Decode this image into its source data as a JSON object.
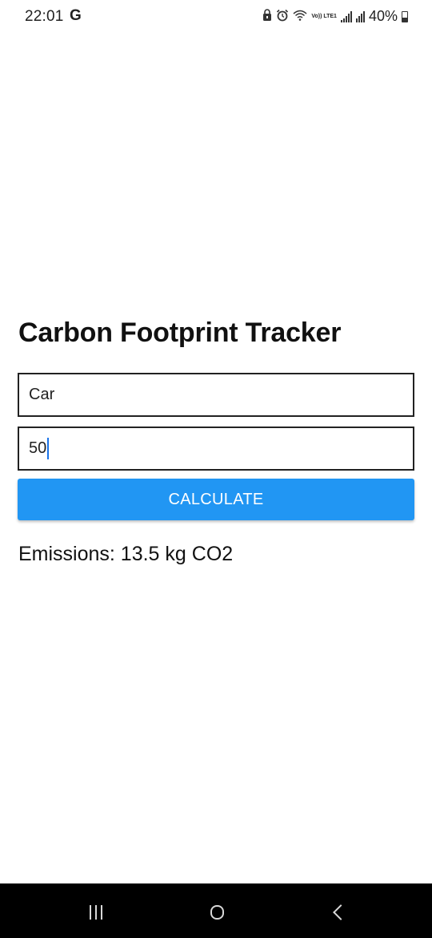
{
  "status_bar": {
    "time": "22:01",
    "google_indicator": "G",
    "network_label": "Vo)) LTE1",
    "battery_percent": "40%",
    "icons": [
      "lock-icon",
      "alarm-icon",
      "wifi-icon",
      "volte-icon",
      "signal-icon",
      "signal-r-icon",
      "battery-icon"
    ]
  },
  "app": {
    "title": "Carbon Footprint Tracker",
    "vehicle_input": {
      "value": "Car"
    },
    "distance_input": {
      "value": "50"
    },
    "calculate_button": {
      "label": "CALCULATE"
    },
    "result_text": "Emissions: 13.5 kg CO2"
  },
  "nav_bar": {
    "icons": [
      "recents-icon",
      "home-icon",
      "back-icon"
    ]
  },
  "colors": {
    "button_background": "#2196F3",
    "button_text": "#ffffff",
    "nav_bar_background": "#000000",
    "text_cursor": "#1a73e8"
  }
}
